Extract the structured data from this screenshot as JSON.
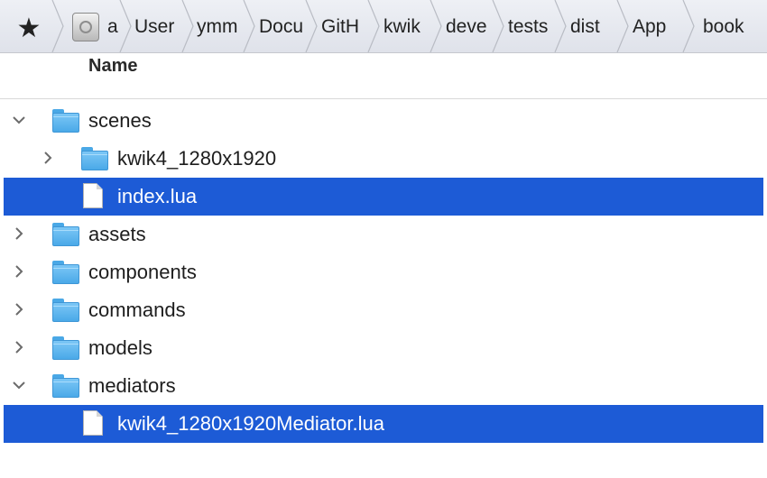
{
  "pathbar": {
    "favorites_glyph": "★",
    "drive_icon": "hard-drive-icon",
    "segments": [
      "a",
      "User",
      "ymm",
      "Docu",
      "GitH",
      "kwik",
      "deve",
      "tests",
      "dist",
      "App",
      "book"
    ]
  },
  "columns": {
    "name": "Name"
  },
  "rows": [
    {
      "label": "scenes",
      "kind": "folder",
      "expanded": true,
      "selected": false
    },
    {
      "label": "kwik4_1280x1920",
      "kind": "folder",
      "expanded": false,
      "selected": false
    },
    {
      "label": "index.lua",
      "kind": "file",
      "selected": true
    },
    {
      "label": "assets",
      "kind": "folder",
      "expanded": false,
      "selected": false
    },
    {
      "label": "components",
      "kind": "folder",
      "expanded": false,
      "selected": false
    },
    {
      "label": "commands",
      "kind": "folder",
      "expanded": false,
      "selected": false
    },
    {
      "label": "models",
      "kind": "folder",
      "expanded": false,
      "selected": false
    },
    {
      "label": "mediators",
      "kind": "folder",
      "expanded": true,
      "selected": false
    },
    {
      "label": "kwik4_1280x1920Mediator.lua",
      "kind": "file",
      "selected": true
    }
  ],
  "colors": {
    "selection": "#1d5bd6",
    "folder": "#5ab4ee",
    "pathbar": "#e4e7ee"
  }
}
